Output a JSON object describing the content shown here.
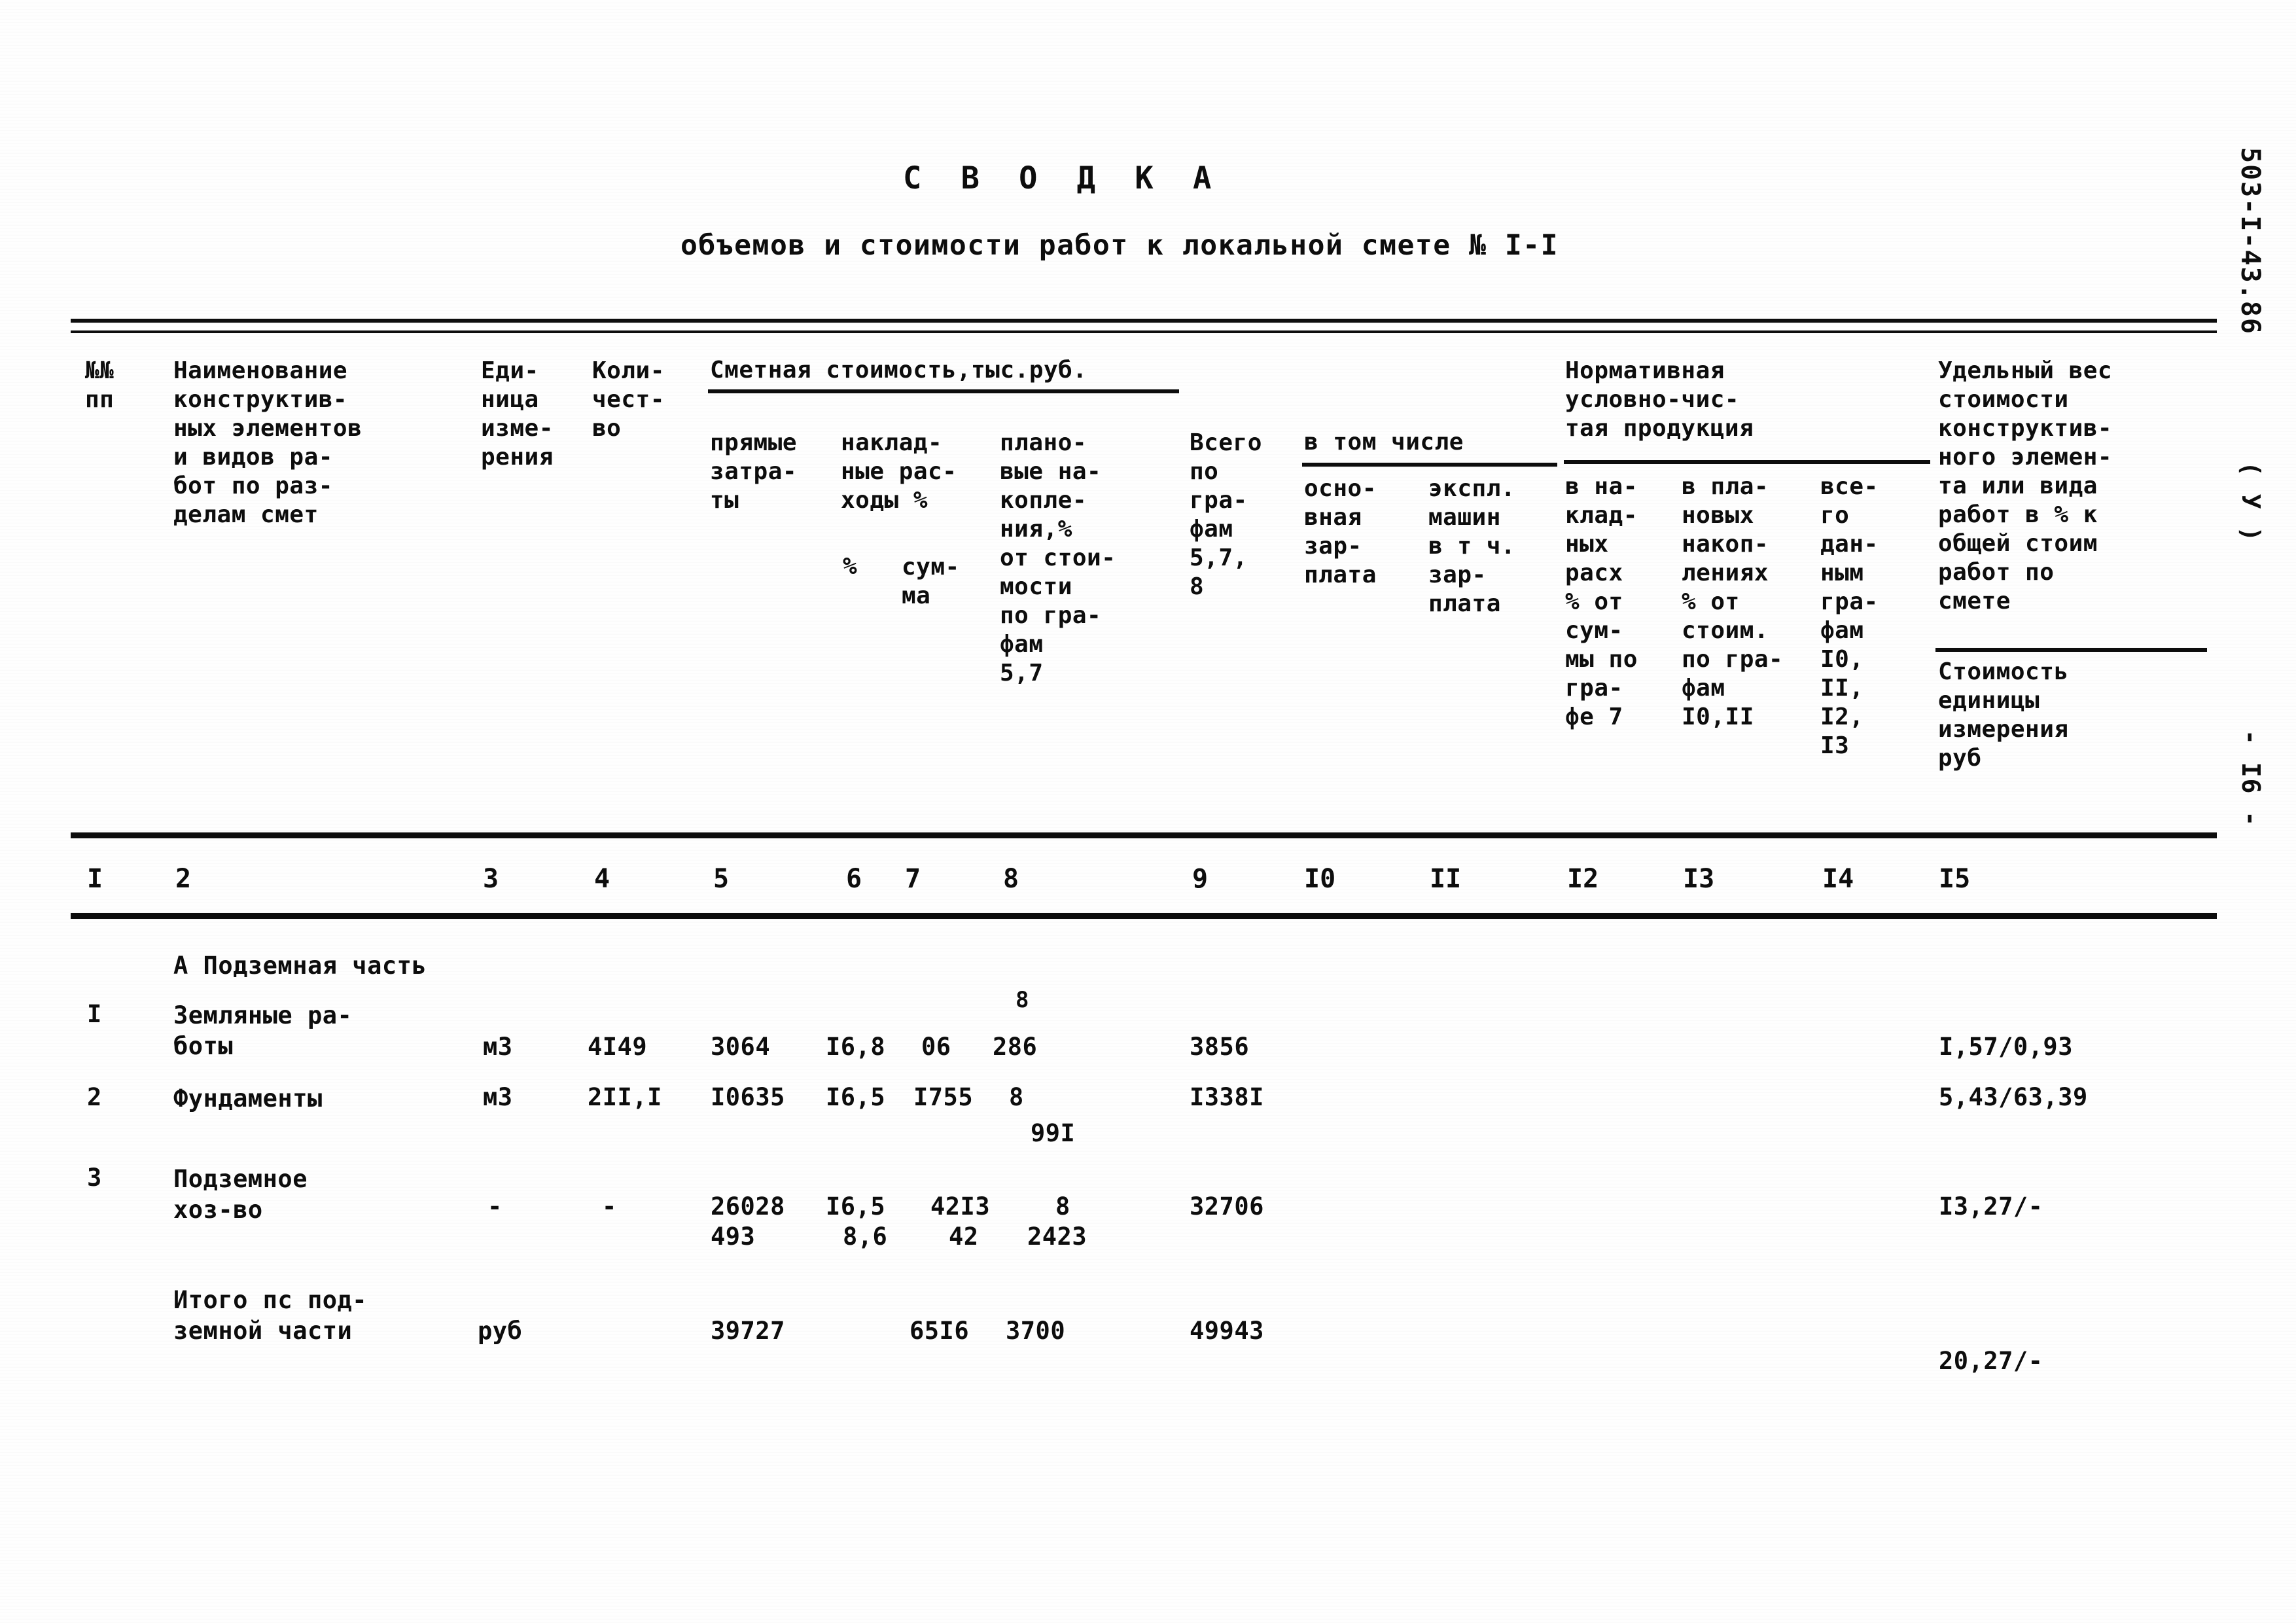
{
  "document": {
    "title": "С В О Д К А",
    "subtitle": "объемов и стоимости работ к локальной смете № I-I",
    "margin_code": "503-I-43.86",
    "margin_mark": "( У )",
    "page_number": "- I6 -"
  },
  "header": {
    "col1": "№№\nпп",
    "col2": "Наименование\nконструктив-\nных элементов\nи видов ра-\nбот по раз-\nделам смет",
    "col3": "Еди-\nница\nизме-\nрения",
    "col4": "Коли-\nчест-\nво",
    "group_smetnaya": "Сметная стоимость,тыс.руб.",
    "col5": "прямые\nзатра-\nты",
    "col6_7": "наклад-\nные рас-\nходы %",
    "col6": "%",
    "col7": "сум-\nма",
    "col8": "плано-\nвые на-\nкопле-\nния,%\nот стои-\nмости\nпо гра-\nфам\n5,7",
    "col9": "Всего\nпо\nгра-\nфам\n5,7,\n8",
    "group_vtomchisle": "в том числе",
    "col10": "осно-\nвная\nзар-\nплата",
    "col11": "экспл.\nмашин\nв т ч.\nзар-\nплата",
    "group_nchp": "Нормативная\nусловно-чис-\nтая продукция",
    "col12": "в на-\nклад-\nных\nрасх\n% от\nсум-\nмы по\nгра-\nфе 7",
    "col13": "в пла-\nновых\nнакоп-\nлениях\n% от\nстоим.\nпо гра-\nфам\nI0,II",
    "col14": "все-\nго\nдан-\nным\nгра-\nфам\nI0,\nII,\nI2,\nI3",
    "col15_top": "Удельный вес\nстоимости\nконструктив-\nного элемен-\nта или вида\nработ в % к\nобщей стоим\nработ по\nсмете",
    "col15_bottom": "Стоимость\nединицы\nизмерения\nруб"
  },
  "column_numbers": [
    "I",
    "2",
    "3",
    "4",
    "5",
    "6",
    "7",
    "8",
    "9",
    "I0",
    "II",
    "I2",
    "I3",
    "I4",
    "I5"
  ],
  "section_heading": "А  Подземная часть",
  "rows": [
    {
      "num": "I",
      "name": "Земляные ра-\nботы",
      "unit": "м3",
      "qty": "4I49",
      "direct": "3064",
      "oh_pct": "I6,8",
      "oh_sum": "06",
      "savings": "286",
      "savings_sup": "8",
      "total": "3856",
      "basic_wage": "",
      "machine_wage": "",
      "nchp_oh": "",
      "nchp_savings": "",
      "nchp_total": "",
      "unit_cost": "I,57/0,93"
    },
    {
      "num": "2",
      "name": "Фундаменты",
      "unit": "м3",
      "qty": "2II,I",
      "direct": "I0635",
      "oh_pct": "I6,5",
      "oh_sum": "I755",
      "savings": "8",
      "savings_second": "99I",
      "total": "I338I",
      "basic_wage": "",
      "machine_wage": "",
      "nchp_oh": "",
      "nchp_savings": "",
      "nchp_total": "",
      "unit_cost": "5,43/63,39"
    },
    {
      "num": "3",
      "name": "Подземное\nхоз-во",
      "unit": "-",
      "qty": "-",
      "direct": "26028",
      "direct_second": "493",
      "oh_pct": "I6,5",
      "oh_pct_second": "8,6",
      "oh_sum": "42I3",
      "oh_sum_second": "42",
      "savings": "8",
      "savings_second": "2423",
      "total": "32706",
      "basic_wage": "",
      "machine_wage": "",
      "nchp_oh": "",
      "nchp_savings": "",
      "nchp_total": "",
      "unit_cost": "I3,27/-"
    }
  ],
  "total_row": {
    "name": "Итого пс под-\nземной части",
    "unit": "руб",
    "qty": "",
    "direct": "39727",
    "oh_sum": "65I6",
    "savings": "3700",
    "total": "49943",
    "unit_cost": "20,27/-"
  }
}
